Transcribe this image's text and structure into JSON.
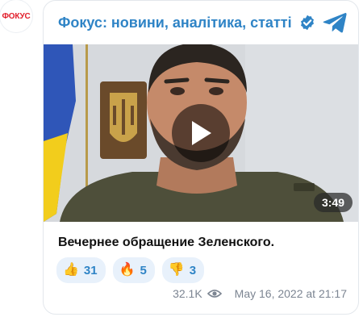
{
  "channel": {
    "avatar_text": "ФОКУС",
    "name": "Фокус: новини, аналітика, статті",
    "verified_icon": "verified-badge-icon",
    "app_icon": "telegram-icon",
    "accent_color": "#2f84c6"
  },
  "post": {
    "video": {
      "duration": "3:49",
      "play_icon": "play-icon"
    },
    "caption": "Вечернее обращение Зеленского.",
    "reactions": [
      {
        "emoji": "👍",
        "count": "31"
      },
      {
        "emoji": "🔥",
        "count": "5"
      },
      {
        "emoji": "👎",
        "count": "3"
      }
    ],
    "views": "32.1K",
    "date": "May 16, 2022 at 21:17"
  }
}
